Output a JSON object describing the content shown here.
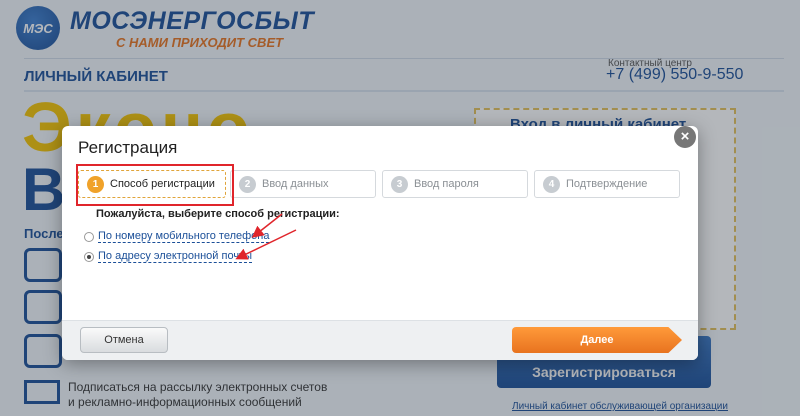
{
  "header": {
    "logo_text": "МЭС",
    "brand": "МОСЭНЕРГОСБЫТ",
    "slogan": "С НАМИ ПРИХОДИТ СВЕТ",
    "cabinet_title": "ЛИЧНЫЙ КАБИНЕТ",
    "contact_label": "Контактный центр",
    "contact_phone": "+7 (499) 550-9-550"
  },
  "background": {
    "side_label": "После",
    "newsletter": "Подписаться на рассылку электронных счетов и рекламно-информационных сообщений",
    "login_title": "Вход в личный кабинет",
    "register_label": "Зарегистрироваться",
    "org_link": "Личный кабинет обслуживающей организации"
  },
  "modal": {
    "title": "Регистрация",
    "close": "×",
    "steps": [
      {
        "num": "1",
        "label": "Способ регистрации",
        "active": true
      },
      {
        "num": "2",
        "label": "Ввод данных",
        "active": false
      },
      {
        "num": "3",
        "label": "Ввод пароля",
        "active": false
      },
      {
        "num": "4",
        "label": "Подтверждение",
        "active": false
      }
    ],
    "prompt": "Пожалуйста, выберите способ регистрации:",
    "options": [
      {
        "label": "По номеру мобильного телефона",
        "checked": false
      },
      {
        "label": "По адресу электронной почты",
        "checked": true
      }
    ],
    "cancel_label": "Отмена",
    "next_label": "Далее"
  },
  "colors": {
    "brand_blue": "#1b4f98",
    "accent_orange": "#e8731f",
    "highlight_red": "#e0252b"
  }
}
